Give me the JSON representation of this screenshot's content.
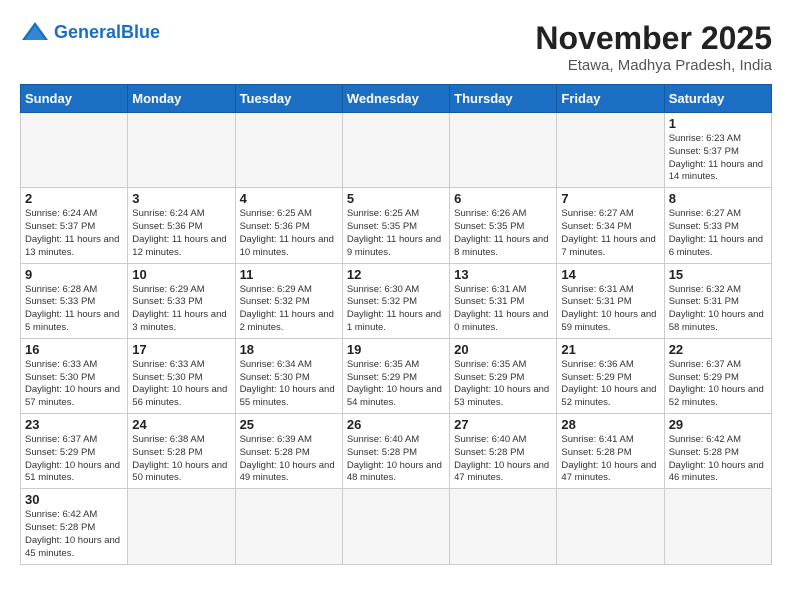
{
  "logo": {
    "text_general": "General",
    "text_blue": "Blue"
  },
  "title": "November 2025",
  "subtitle": "Etawa, Madhya Pradesh, India",
  "headers": [
    "Sunday",
    "Monday",
    "Tuesday",
    "Wednesday",
    "Thursday",
    "Friday",
    "Saturday"
  ],
  "weeks": [
    [
      {
        "day": "",
        "info": ""
      },
      {
        "day": "",
        "info": ""
      },
      {
        "day": "",
        "info": ""
      },
      {
        "day": "",
        "info": ""
      },
      {
        "day": "",
        "info": ""
      },
      {
        "day": "",
        "info": ""
      },
      {
        "day": "1",
        "info": "Sunrise: 6:23 AM\nSunset: 5:37 PM\nDaylight: 11 hours and 14 minutes."
      }
    ],
    [
      {
        "day": "2",
        "info": "Sunrise: 6:24 AM\nSunset: 5:37 PM\nDaylight: 11 hours and 13 minutes."
      },
      {
        "day": "3",
        "info": "Sunrise: 6:24 AM\nSunset: 5:36 PM\nDaylight: 11 hours and 12 minutes."
      },
      {
        "day": "4",
        "info": "Sunrise: 6:25 AM\nSunset: 5:36 PM\nDaylight: 11 hours and 10 minutes."
      },
      {
        "day": "5",
        "info": "Sunrise: 6:25 AM\nSunset: 5:35 PM\nDaylight: 11 hours and 9 minutes."
      },
      {
        "day": "6",
        "info": "Sunrise: 6:26 AM\nSunset: 5:35 PM\nDaylight: 11 hours and 8 minutes."
      },
      {
        "day": "7",
        "info": "Sunrise: 6:27 AM\nSunset: 5:34 PM\nDaylight: 11 hours and 7 minutes."
      },
      {
        "day": "8",
        "info": "Sunrise: 6:27 AM\nSunset: 5:33 PM\nDaylight: 11 hours and 6 minutes."
      }
    ],
    [
      {
        "day": "9",
        "info": "Sunrise: 6:28 AM\nSunset: 5:33 PM\nDaylight: 11 hours and 5 minutes."
      },
      {
        "day": "10",
        "info": "Sunrise: 6:29 AM\nSunset: 5:33 PM\nDaylight: 11 hours and 3 minutes."
      },
      {
        "day": "11",
        "info": "Sunrise: 6:29 AM\nSunset: 5:32 PM\nDaylight: 11 hours and 2 minutes."
      },
      {
        "day": "12",
        "info": "Sunrise: 6:30 AM\nSunset: 5:32 PM\nDaylight: 11 hours and 1 minute."
      },
      {
        "day": "13",
        "info": "Sunrise: 6:31 AM\nSunset: 5:31 PM\nDaylight: 11 hours and 0 minutes."
      },
      {
        "day": "14",
        "info": "Sunrise: 6:31 AM\nSunset: 5:31 PM\nDaylight: 10 hours and 59 minutes."
      },
      {
        "day": "15",
        "info": "Sunrise: 6:32 AM\nSunset: 5:31 PM\nDaylight: 10 hours and 58 minutes."
      }
    ],
    [
      {
        "day": "16",
        "info": "Sunrise: 6:33 AM\nSunset: 5:30 PM\nDaylight: 10 hours and 57 minutes."
      },
      {
        "day": "17",
        "info": "Sunrise: 6:33 AM\nSunset: 5:30 PM\nDaylight: 10 hours and 56 minutes."
      },
      {
        "day": "18",
        "info": "Sunrise: 6:34 AM\nSunset: 5:30 PM\nDaylight: 10 hours and 55 minutes."
      },
      {
        "day": "19",
        "info": "Sunrise: 6:35 AM\nSunset: 5:29 PM\nDaylight: 10 hours and 54 minutes."
      },
      {
        "day": "20",
        "info": "Sunrise: 6:35 AM\nSunset: 5:29 PM\nDaylight: 10 hours and 53 minutes."
      },
      {
        "day": "21",
        "info": "Sunrise: 6:36 AM\nSunset: 5:29 PM\nDaylight: 10 hours and 52 minutes."
      },
      {
        "day": "22",
        "info": "Sunrise: 6:37 AM\nSunset: 5:29 PM\nDaylight: 10 hours and 52 minutes."
      }
    ],
    [
      {
        "day": "23",
        "info": "Sunrise: 6:37 AM\nSunset: 5:29 PM\nDaylight: 10 hours and 51 minutes."
      },
      {
        "day": "24",
        "info": "Sunrise: 6:38 AM\nSunset: 5:28 PM\nDaylight: 10 hours and 50 minutes."
      },
      {
        "day": "25",
        "info": "Sunrise: 6:39 AM\nSunset: 5:28 PM\nDaylight: 10 hours and 49 minutes."
      },
      {
        "day": "26",
        "info": "Sunrise: 6:40 AM\nSunset: 5:28 PM\nDaylight: 10 hours and 48 minutes."
      },
      {
        "day": "27",
        "info": "Sunrise: 6:40 AM\nSunset: 5:28 PM\nDaylight: 10 hours and 47 minutes."
      },
      {
        "day": "28",
        "info": "Sunrise: 6:41 AM\nSunset: 5:28 PM\nDaylight: 10 hours and 47 minutes."
      },
      {
        "day": "29",
        "info": "Sunrise: 6:42 AM\nSunset: 5:28 PM\nDaylight: 10 hours and 46 minutes."
      }
    ],
    [
      {
        "day": "30",
        "info": "Sunrise: 6:42 AM\nSunset: 5:28 PM\nDaylight: 10 hours and 45 minutes."
      },
      {
        "day": "",
        "info": ""
      },
      {
        "day": "",
        "info": ""
      },
      {
        "day": "",
        "info": ""
      },
      {
        "day": "",
        "info": ""
      },
      {
        "day": "",
        "info": ""
      },
      {
        "day": "",
        "info": ""
      }
    ]
  ]
}
